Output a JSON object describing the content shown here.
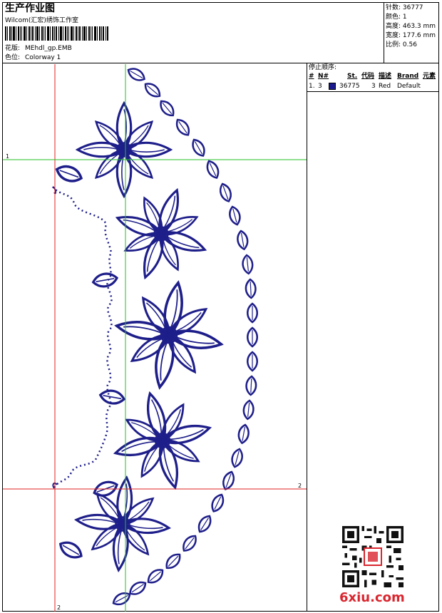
{
  "header": {
    "title": "生产作业图",
    "company": "Wilcom(汇宏)绣饰工作室",
    "design_label": "花版:",
    "design_file": "MEhdl_gp.EMB",
    "colorway_label": "色位:",
    "colorway": "Colorway 1"
  },
  "stats": {
    "stitches": "针数: 36777",
    "colors": "颜色: 1",
    "height": "高度: 463.3 mm",
    "width": "宽度: 177.6 mm",
    "scale": "比例: 0.56"
  },
  "stop_sequence": {
    "title": "停止顺序:",
    "headers": [
      "#",
      "N#",
      "St.",
      "代码",
      "描述",
      "Brand",
      "元素"
    ],
    "rows": [
      {
        "num": "1.",
        "needle": "3",
        "stitches": "36775",
        "code": "3",
        "desc": "Red",
        "brand": "Default",
        "swatch_color": "#1a1a8c"
      }
    ]
  },
  "guides": {
    "label_h1": "1",
    "label_h2": "2",
    "label_v2": "2"
  },
  "colors": {
    "thread": "#1e1e8a",
    "guide_red": "#e02020",
    "guide_green": "#20c020"
  },
  "watermark": {
    "logo_text": "6xiu.com"
  }
}
